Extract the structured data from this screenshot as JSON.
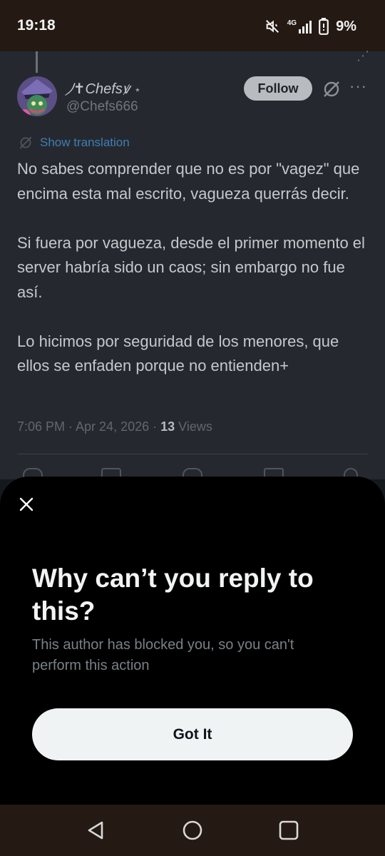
{
  "status_bar": {
    "time": "19:18",
    "network": "4G",
    "battery": "9%"
  },
  "tweet": {
    "display_name": "⵰✝Chefsꝟ",
    "verified_mark": "⋆",
    "handle": "@Chefs666",
    "follow_label": "Follow",
    "show_translation": "Show translation",
    "paragraphs": [
      "No sabes comprender que no es por \"vagez\" que encima esta mal escrito, vagueza querrás decir.",
      "Si fuera por vagueza, desde el primer momento el server habría sido un caos; sin embargo no fue así.",
      "Lo hicimos por seguridad de los menores, que ellos se enfaden porque no entienden+"
    ],
    "timestamp": "7:06 PM · Apr 24, 2026 · ",
    "views_count": "13",
    "views_label": " Views"
  },
  "sheet": {
    "title": "Why can’t you reply to this?",
    "description": "This author has blocked you, so you can't perform this action",
    "button_label": "Got It"
  },
  "colors": {
    "accent_link": "#3e7fb4",
    "sheet_bg": "#000000",
    "button_bg": "#eff3f4"
  }
}
